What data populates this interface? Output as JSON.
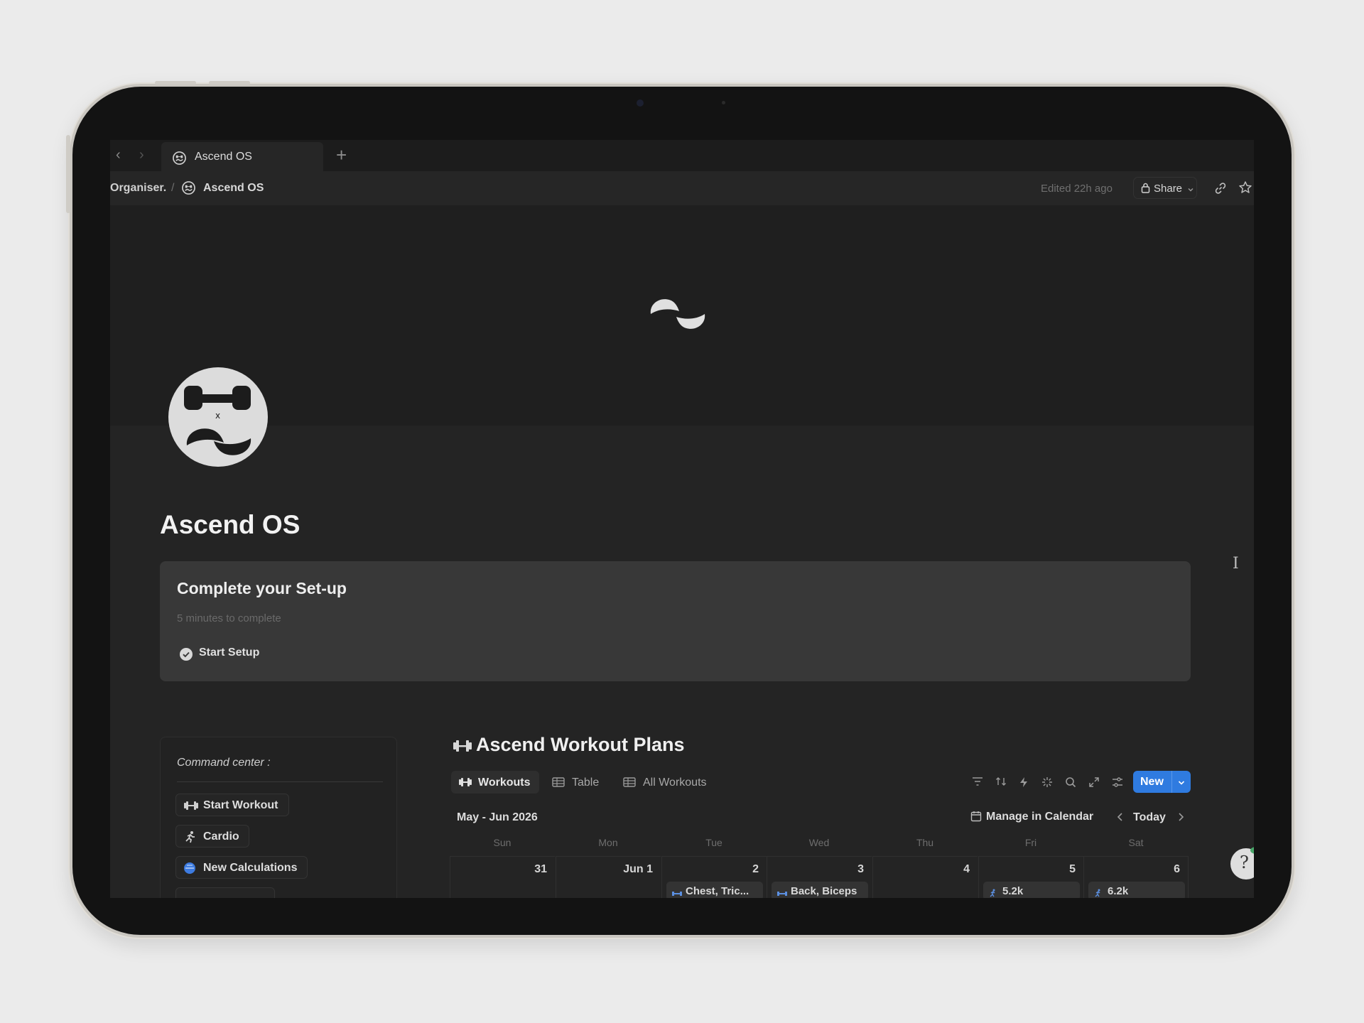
{
  "tab": {
    "title": "Ascend OS",
    "add": "+"
  },
  "nav": {
    "back": "‹",
    "forward": "›"
  },
  "breadcrumb": {
    "workspace": "Organiser.",
    "separator": "/",
    "page": "Ascend OS"
  },
  "topbar": {
    "edited": "Edited 22h ago",
    "share": "Share"
  },
  "page": {
    "title": "Ascend OS"
  },
  "callout": {
    "title": "Complete your Set-up",
    "subtitle": "5 minutes to complete",
    "action": "Start Setup"
  },
  "command_center": {
    "title": "Command center :",
    "buttons": [
      "Start Workout",
      "Cardio",
      "New Calculations"
    ]
  },
  "database": {
    "title": "Ascend Workout Plans",
    "views": [
      "Workouts",
      "Table",
      "All Workouts"
    ],
    "new_label": "New"
  },
  "calendar": {
    "month": "May - Jun 2026",
    "manage": "Manage in Calendar",
    "today": "Today",
    "weekdays": [
      "Sun",
      "Mon",
      "Tue",
      "Wed",
      "Thu",
      "Fri",
      "Sat"
    ],
    "days": [
      "31",
      "Jun 1",
      "2",
      "3",
      "4",
      "5",
      "6"
    ],
    "events": {
      "tue": "Chest, Tric...",
      "wed": "Back, Biceps",
      "fri": "5.2k",
      "sat": "6.2k"
    }
  },
  "colors": {
    "accent": "#2f7be0",
    "background": "#242424",
    "cover": "#1f1f1f",
    "callout": "#383838"
  },
  "misc": {
    "cursor": "I",
    "help": "?"
  }
}
